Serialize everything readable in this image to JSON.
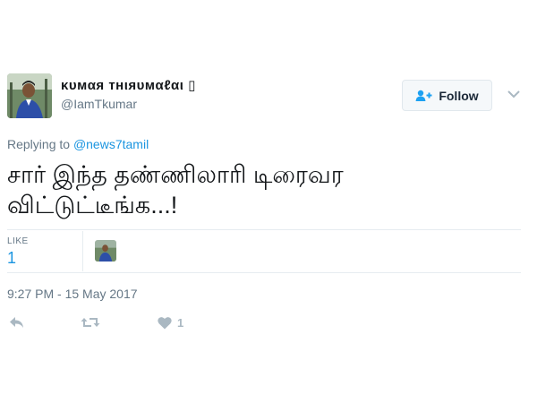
{
  "user": {
    "display_name": "κυмαя тнιяυмαℓαι",
    "name_suffix_glyph": "▯",
    "handle": "@IamTkumar"
  },
  "follow_button": {
    "label": "Follow",
    "icon": "person-add-icon"
  },
  "reply_context": {
    "prefix": "Replying to",
    "mention": "@news7tamil"
  },
  "tweet": {
    "text_line1": "சார் இந்த தண்ணிலாரி டிரைவர",
    "text_line2": "விட்டுட்டீங்க...!",
    "timestamp": "9:27 PM - 15 May 2017"
  },
  "stats": {
    "like_label": "LIKE",
    "like_count": "1"
  },
  "actions": {
    "reply_icon": "reply-icon",
    "retweet_icon": "retweet-icon",
    "like_icon": "heart-icon",
    "like_count": "1"
  },
  "colors": {
    "link": "#1b95e0",
    "muted": "#657786",
    "icon": "#aab8c2",
    "text": "#14171a",
    "brand_blue": "#1da1f2"
  }
}
